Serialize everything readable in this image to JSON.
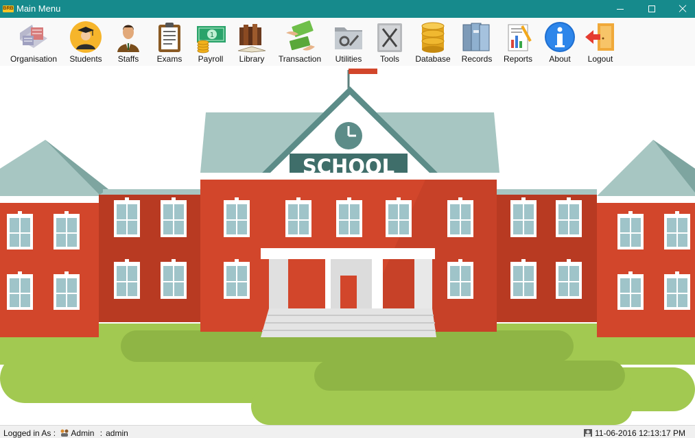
{
  "window": {
    "title": "Main Menu",
    "app_icon_text": "BRB"
  },
  "toolbar": {
    "items": [
      {
        "label": "Organisation",
        "icon": "organisation-icon"
      },
      {
        "label": "Students",
        "icon": "students-icon"
      },
      {
        "label": "Staffs",
        "icon": "staffs-icon"
      },
      {
        "label": "Exams",
        "icon": "exams-icon"
      },
      {
        "label": "Payroll",
        "icon": "payroll-icon"
      },
      {
        "label": "Library",
        "icon": "library-icon"
      },
      {
        "label": "Transaction",
        "icon": "transaction-icon"
      },
      {
        "label": "Utilities",
        "icon": "utilities-icon"
      },
      {
        "label": "Tools",
        "icon": "tools-icon"
      },
      {
        "label": "Database",
        "icon": "database-icon"
      },
      {
        "label": "Records",
        "icon": "records-icon"
      },
      {
        "label": "Reports",
        "icon": "reports-icon"
      },
      {
        "label": "About",
        "icon": "about-icon"
      },
      {
        "label": "Logout",
        "icon": "logout-icon"
      }
    ]
  },
  "banner": {
    "sign_text": "SCHOOL"
  },
  "status": {
    "logged_in_label": "Logged in As :",
    "role": "Admin",
    "separator": ":",
    "username": "admin",
    "datetime": "11-06-2016 12:13:17 PM"
  },
  "colors": {
    "titlebar": "#168a8c",
    "brick": "#d2462b",
    "roof": "#a7c6c2",
    "grass": "#a2c951"
  }
}
